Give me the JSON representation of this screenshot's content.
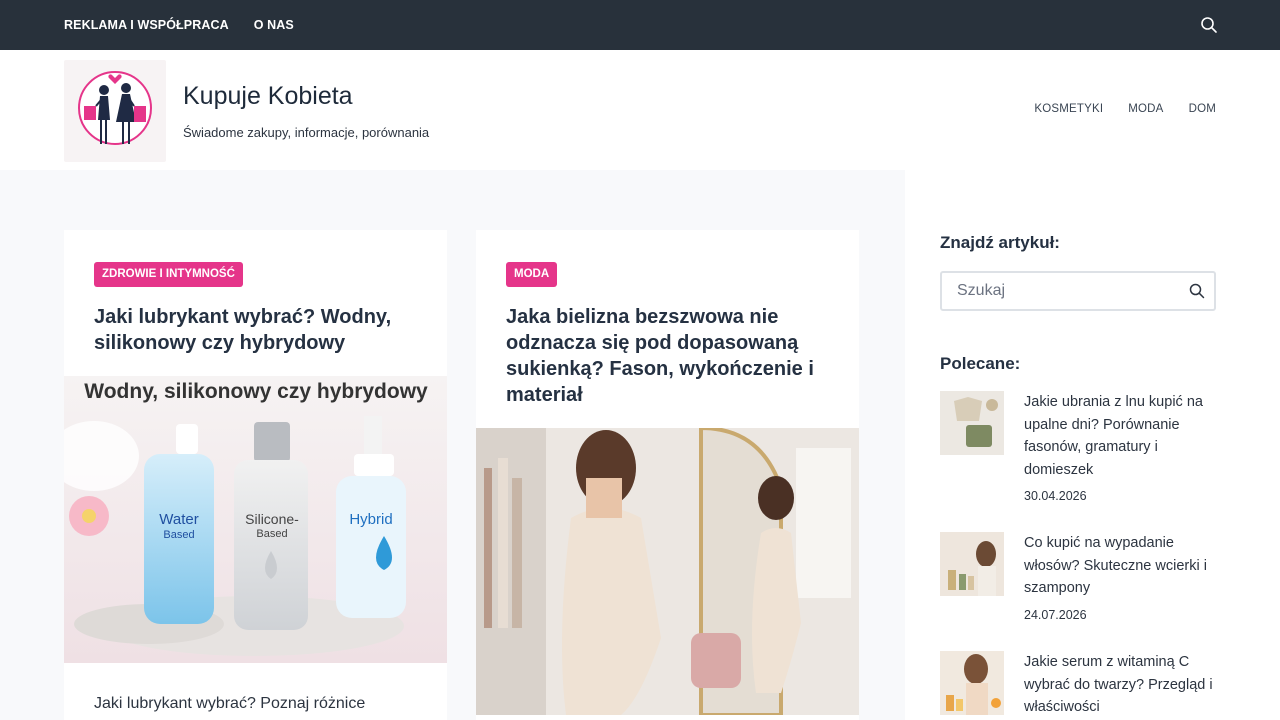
{
  "topbar": {
    "links": [
      "REKLAMA I WSPÓŁPRACA",
      "O NAS"
    ],
    "search_icon": "search-icon"
  },
  "header": {
    "title": "Kupuje Kobieta",
    "tagline": "Świadome zakupy, informacje, porównania",
    "nav": [
      "KOSMETYKI",
      "MODA",
      "DOM"
    ]
  },
  "posts": [
    {
      "category": "ZDROWIE I INTYMNOŚĆ",
      "title": "Jaki lubrykant wybrać? Wodny, silikonowy czy hybrydowy",
      "image_heading": "Wodny, silikonowy czy hybrydowy",
      "bottles": [
        {
          "label": "Water",
          "sub": "Based"
        },
        {
          "label": "Silicone-",
          "sub": "Based"
        },
        {
          "label": "Hybrid",
          "sub": ""
        }
      ],
      "excerpt": "Jaki lubrykant wybrać? Poznaj różnice"
    },
    {
      "category": "MODA",
      "title": "Jaka bielizna bezszwowa nie odznacza się pod dopasowaną sukienką? Fason, wykończenie i materiał"
    }
  ],
  "sidebar": {
    "search_heading": "Znajdź artykuł:",
    "search_placeholder": "Szukaj",
    "recommended_heading": "Polecane:",
    "recommended": [
      {
        "title": "Jakie ubrania z lnu kupić na upalne dni? Porównanie fasonów, gramatury i domieszek",
        "date": "30.04.2026"
      },
      {
        "title": "Co kupić na wypadanie włosów? Skuteczne wcierki i szampony",
        "date": "24.07.2026"
      },
      {
        "title": "Jakie serum z witaminą C wybrać do twarzy? Przegląd i właściwości",
        "date": ""
      }
    ]
  },
  "colors": {
    "topbar": "#28313b",
    "accent": "#e5358a",
    "text": "#2c3440"
  }
}
